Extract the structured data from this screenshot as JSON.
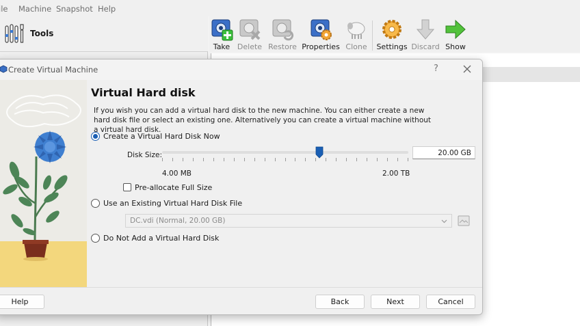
{
  "menubar": {
    "items": [
      "ile",
      "Machine",
      "Snapshot",
      "Help"
    ]
  },
  "tools": {
    "label": "Tools"
  },
  "toolbar": {
    "buttons": [
      {
        "label": "Take",
        "icon": "camera-plus-icon",
        "enabled": true
      },
      {
        "label": "Delete",
        "icon": "camera-delete-icon",
        "enabled": false
      },
      {
        "label": "Restore",
        "icon": "camera-restore-icon",
        "enabled": false
      },
      {
        "label": "Properties",
        "icon": "camera-settings-icon",
        "enabled": true
      },
      {
        "label": "Clone",
        "icon": "sheep-icon",
        "enabled": false
      },
      {
        "label": "Settings",
        "icon": "gear-icon",
        "enabled": true
      },
      {
        "label": "Discard",
        "icon": "arrow-down-icon",
        "enabled": false
      },
      {
        "label": "Show",
        "icon": "arrow-right-icon",
        "enabled": true
      }
    ]
  },
  "dialog": {
    "title": "Create Virtual Machine",
    "help_glyph": "?",
    "page_title": "Virtual Hard disk",
    "description": "If you wish you can add a virtual hard disk to the new machine. You can either create a new hard disk file or select an existing one. Alternatively you can create a virtual machine without a virtual hard disk.",
    "options": {
      "create_now": {
        "label": "Create a Virtual Hard Disk Now",
        "checked": true
      },
      "use_existing": {
        "label": "Use an Existing Virtual Hard Disk File",
        "checked": false
      },
      "do_not_add": {
        "label": "Do Not Add a Virtual Hard Disk",
        "checked": false
      }
    },
    "disk_size": {
      "label": "Disk Size:",
      "value": "20.00 GB",
      "min_label": "4.00 MB",
      "max_label": "2.00 TB",
      "slider_fraction": 0.64
    },
    "preallocate": {
      "label": "Pre-allocate Full Size",
      "checked": false
    },
    "existing_file": {
      "value": "DC.vdi (Normal, 20.00 GB)"
    },
    "buttons": {
      "help": "Help",
      "back": "Back",
      "next": "Next",
      "cancel": "Cancel"
    }
  },
  "colors": {
    "accent": "#1a5fb4",
    "dialog_bg": "#f0f0f0",
    "art_floor": "#f3d77d",
    "flower": "#3f7fd0"
  }
}
